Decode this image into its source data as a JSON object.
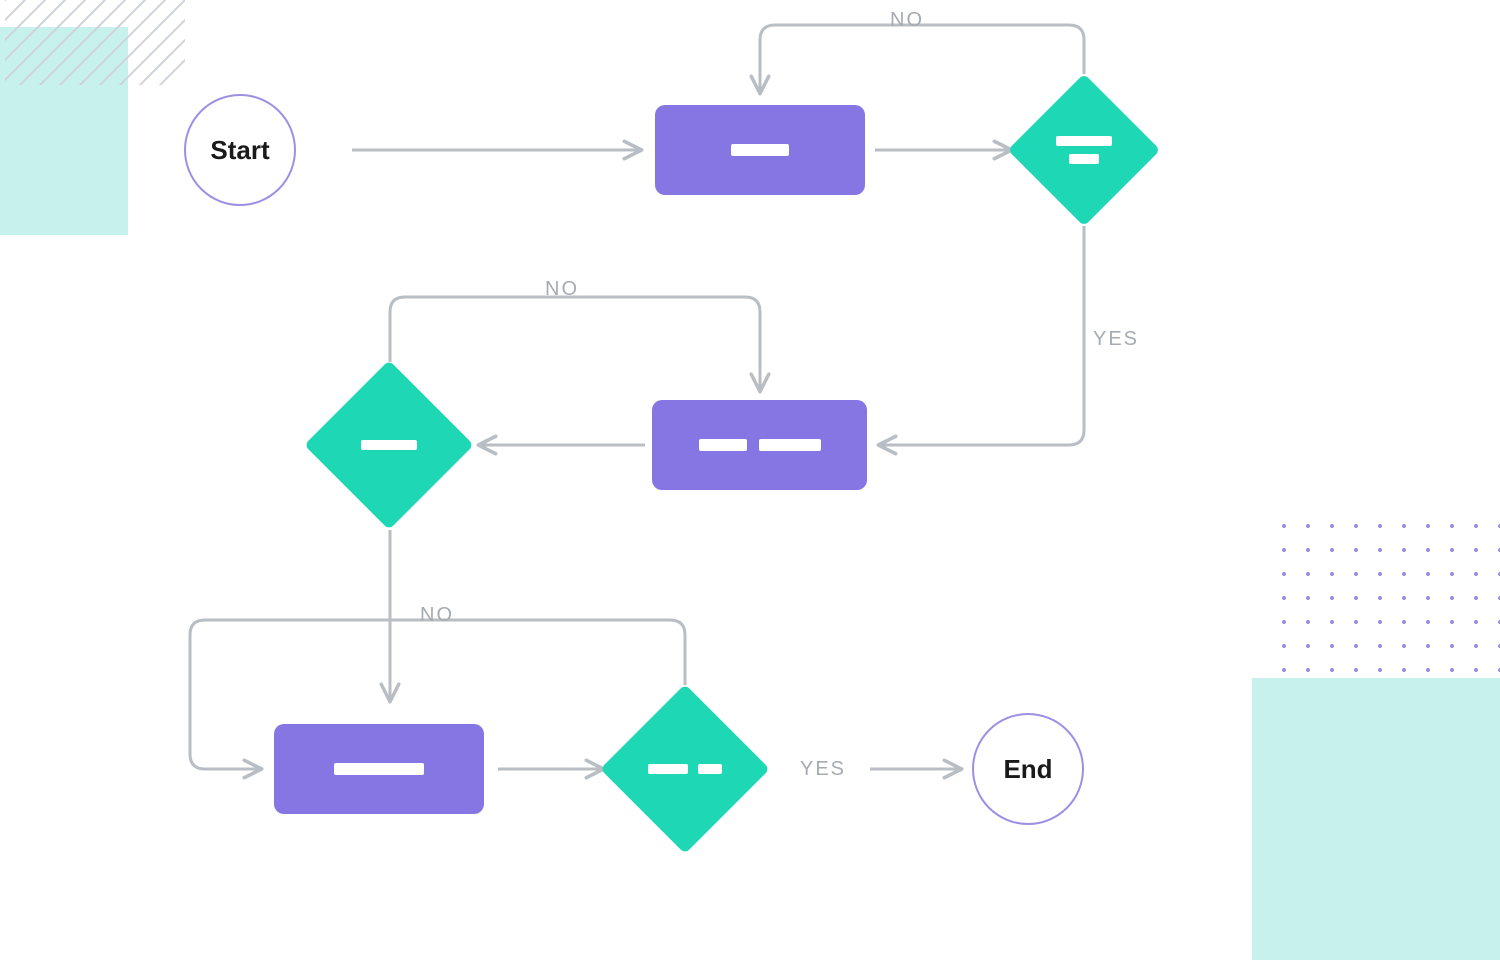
{
  "nodes": {
    "start": {
      "label": "Start"
    },
    "end": {
      "label": "End"
    }
  },
  "labels": {
    "no1": "NO",
    "yes1": "YES",
    "no2": "NO",
    "no3": "NO",
    "yes3": "YES"
  },
  "colors": {
    "terminatorStroke": "#9e8fe4",
    "process": "#8676e3",
    "decision": "#1ed7b5",
    "edge": "#b9bec4",
    "mint": "#c7f1ec",
    "text": "#1a1a1a",
    "labelText": "#a6abb2"
  },
  "chart_data": {
    "type": "flowchart",
    "nodes": [
      {
        "id": "start",
        "kind": "terminator",
        "label": "Start"
      },
      {
        "id": "p1",
        "kind": "process"
      },
      {
        "id": "d1",
        "kind": "decision"
      },
      {
        "id": "p2",
        "kind": "process"
      },
      {
        "id": "d2",
        "kind": "decision"
      },
      {
        "id": "p3",
        "kind": "process"
      },
      {
        "id": "d3",
        "kind": "decision"
      },
      {
        "id": "end",
        "kind": "terminator",
        "label": "End"
      }
    ],
    "edges": [
      {
        "from": "start",
        "to": "p1"
      },
      {
        "from": "p1",
        "to": "d1"
      },
      {
        "from": "d1",
        "to": "p1",
        "label": "NO"
      },
      {
        "from": "d1",
        "to": "p2",
        "label": "YES"
      },
      {
        "from": "p2",
        "to": "d2"
      },
      {
        "from": "d2",
        "to": "p2",
        "label": "NO"
      },
      {
        "from": "d2",
        "to": "p3"
      },
      {
        "from": "p3",
        "to": "d3"
      },
      {
        "from": "d3",
        "to": "p3",
        "label": "NO"
      },
      {
        "from": "d3",
        "to": "end",
        "label": "YES"
      }
    ]
  }
}
